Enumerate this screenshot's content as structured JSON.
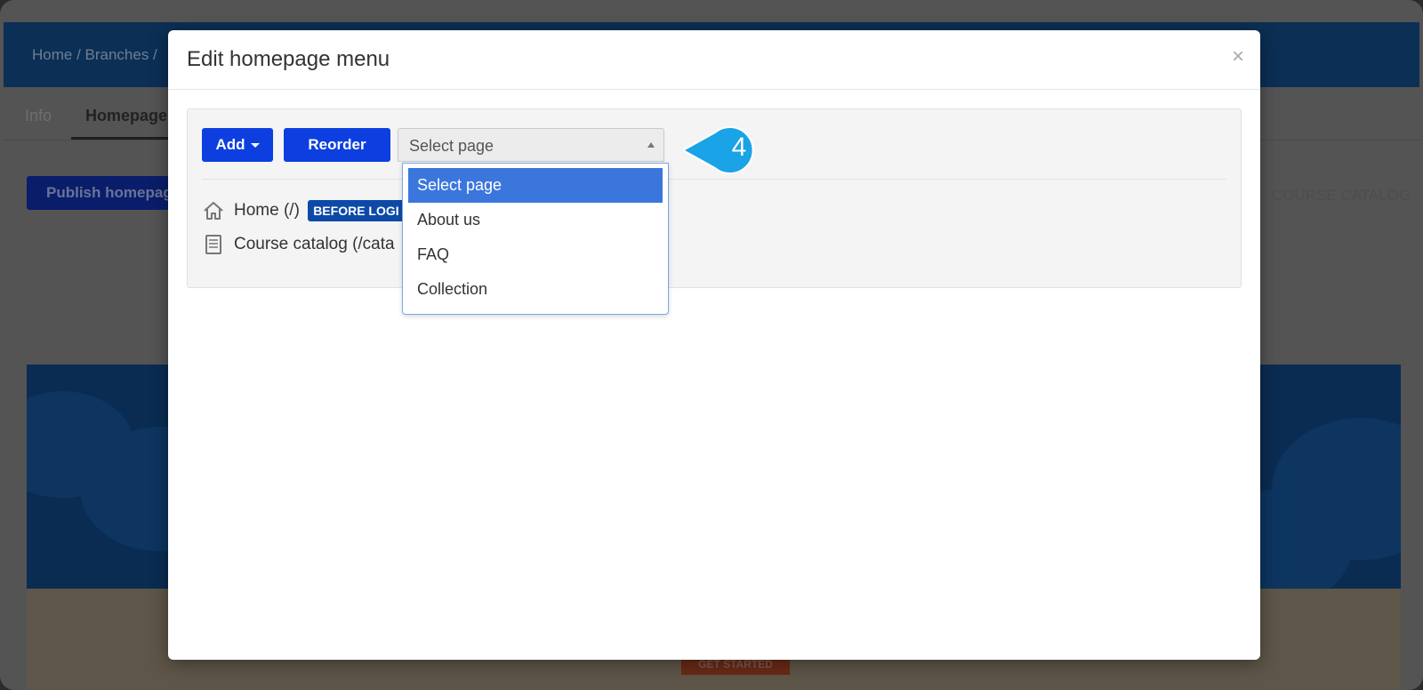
{
  "background": {
    "breadcrumb": "Home / Branches /",
    "tabs": [
      "Info",
      "Homepage"
    ],
    "publish_button": "Publish homepage",
    "right_nav_item": "COURSE CATALOG",
    "hero_button": "GET STARTED"
  },
  "modal": {
    "title": "Edit homepage menu",
    "close": "×",
    "toolbar": {
      "add_label": "Add",
      "reorder_label": "Reorder",
      "select_value": "Select page"
    },
    "menu_items": [
      {
        "label": "Home (/)",
        "badge": "BEFORE LOGI",
        "icon": "home-icon"
      },
      {
        "label": "Course catalog (/cata",
        "icon": "book-icon"
      }
    ],
    "dropdown_options": [
      "Select page",
      "About us",
      "FAQ",
      "Collection"
    ],
    "selected_option": "Select page"
  },
  "callout": {
    "step": "4"
  },
  "colors": {
    "primary_button": "#0d3fe0",
    "dropdown_highlight": "#3b76dd",
    "callout": "#1aa3e6",
    "badge": "#0d4aa8"
  }
}
